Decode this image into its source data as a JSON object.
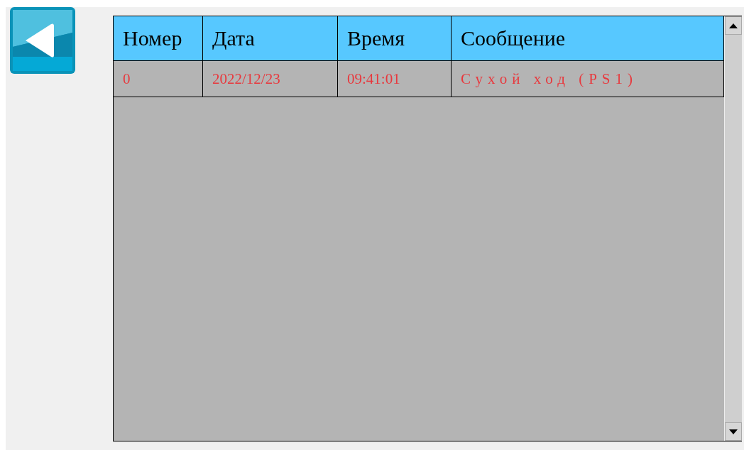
{
  "table": {
    "columns": [
      "Номер",
      "Дата",
      "Время",
      "Сообщение"
    ],
    "rows": [
      {
        "cells": [
          "0",
          "2022/12/23",
          "09:41:01",
          "Сухой ход (PS1)"
        ]
      }
    ]
  }
}
